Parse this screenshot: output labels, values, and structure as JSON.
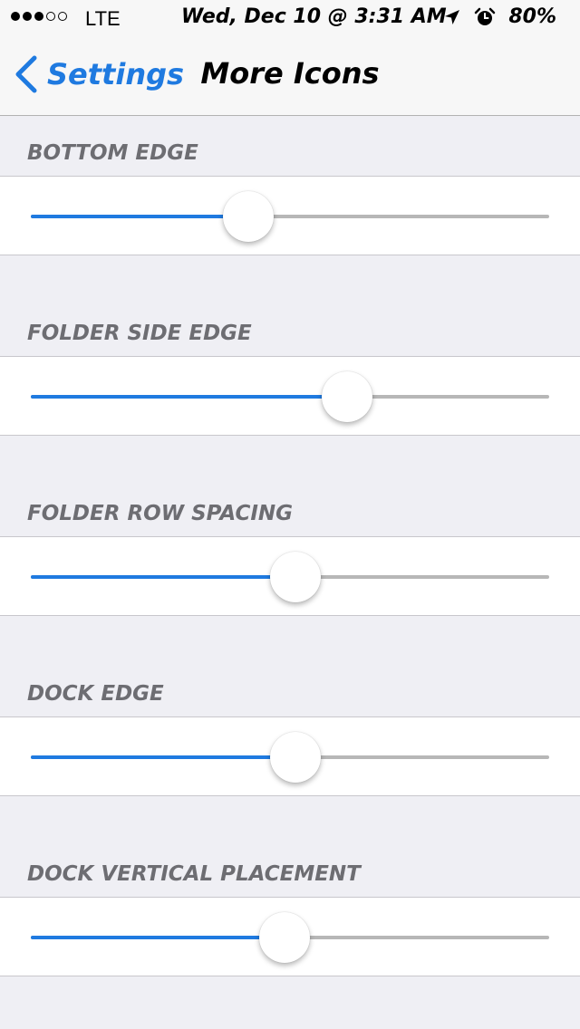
{
  "status_bar": {
    "carrier": "LTE",
    "signal_bars_filled": 3,
    "signal_bars_total": 5,
    "datetime": "Wed, Dec 10 @ 3:31 AM",
    "battery": "80%",
    "icons": [
      "location-arrow-icon",
      "alarm-clock-icon"
    ]
  },
  "nav": {
    "back_label": "Settings",
    "title": "More Icons"
  },
  "colors": {
    "accent": "#1f7ae0",
    "track": "#b7b7b7",
    "group_background": "#efeff4",
    "header_text": "#6d6d72"
  },
  "sliders": [
    {
      "label": "BOTTOM EDGE",
      "value": 0.42
    },
    {
      "label": "FOLDER SIDE EDGE",
      "value": 0.61
    },
    {
      "label": "FOLDER ROW SPACING",
      "value": 0.51
    },
    {
      "label": "DOCK EDGE",
      "value": 0.51
    },
    {
      "label": "DOCK VERTICAL PLACEMENT",
      "value": 0.49
    }
  ]
}
